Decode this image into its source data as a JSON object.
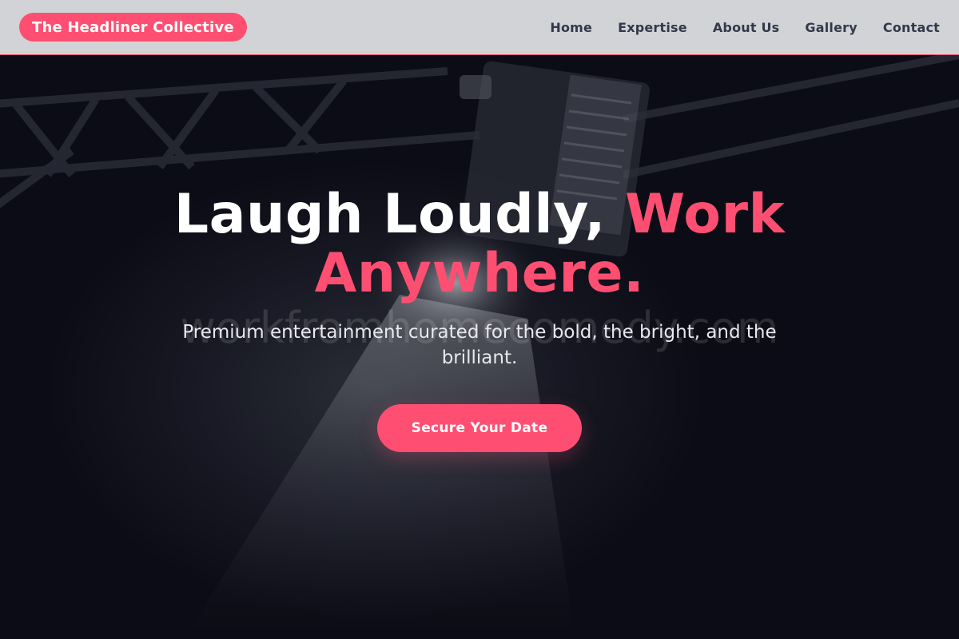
{
  "header": {
    "brand": "The Headliner Collective",
    "nav": [
      {
        "label": "Home"
      },
      {
        "label": "Expertise"
      },
      {
        "label": "About Us"
      },
      {
        "label": "Gallery"
      },
      {
        "label": "Contact"
      }
    ]
  },
  "hero": {
    "title_white": "Laugh Loudly,",
    "title_accent_1": "Work",
    "title_accent_2": "Anywhere.",
    "subtitle": "Premium entertainment curated for the bold, the bright, and the brilliant.",
    "cta_label": "Secure Your Date",
    "watermark": "workfromhomecomedy.com"
  },
  "colors": {
    "accent": "#fe4f72",
    "header_bg": "#d1d3d6",
    "nav_text": "#33394a",
    "hero_bg": "#0b0c15"
  }
}
